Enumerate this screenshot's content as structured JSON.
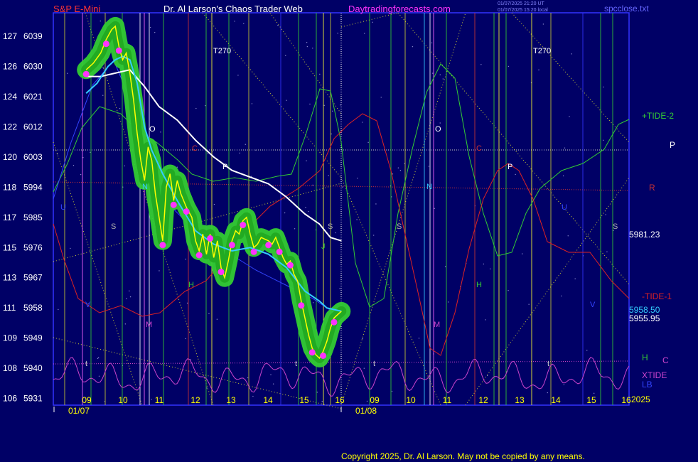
{
  "header": {
    "instrument": "S&P E-Mini",
    "author": "Dr. Al Larson's Chaos Trader Web",
    "site": "Daytradingforecasts.com",
    "timestamp1": "01/07/2025 21:20 UT",
    "timestamp2": "01/07/2025 15:20 local",
    "file": "spcclose.txt"
  },
  "footer": {
    "copyright": "Copyright 2025, Dr. Al Larson. May not be copied by any means."
  },
  "colors": {
    "background": "#000066",
    "plot_border": "#3333ff",
    "price": "#ffff00",
    "white_ma": "#ffffff",
    "cyan_ma": "#33ccff",
    "tide_plus": "#33cc33",
    "tide_minus": "#dd2222",
    "xtide": "#cc44cc"
  },
  "chart_data": {
    "type": "line",
    "y_axis_left": {
      "ticks": [
        {
          "a": "127",
          "b": "6039",
          "v": 6039
        },
        {
          "a": "126",
          "b": "6030",
          "v": 6030
        },
        {
          "a": "124",
          "b": "6021",
          "v": 6021
        },
        {
          "a": "122",
          "b": "6012",
          "v": 6012
        },
        {
          "a": "120",
          "b": "6003",
          "v": 6003
        },
        {
          "a": "118",
          "b": "5994",
          "v": 5994
        },
        {
          "a": "117",
          "b": "5985",
          "v": 5985
        },
        {
          "a": "115",
          "b": "5976",
          "v": 5976
        },
        {
          "a": "113",
          "b": "5967",
          "v": 5967
        },
        {
          "a": "111",
          "b": "5958",
          "v": 5958
        },
        {
          "a": "109",
          "b": "5949",
          "v": 5949
        },
        {
          "a": "108",
          "b": "5940",
          "v": 5940
        },
        {
          "a": "106",
          "b": "5931",
          "v": 5931
        }
      ]
    },
    "ylim": [
      5929,
      6046
    ],
    "x_axis": {
      "hours": [
        "09",
        "10",
        "11",
        "12",
        "13",
        "14",
        "15",
        "16",
        "09",
        "10",
        "11",
        "12",
        "13",
        "14",
        "15",
        "16"
      ],
      "dates": [
        "01/07",
        "01/08"
      ],
      "year": "2025"
    },
    "price_series": [
      [
        0.0,
        6029
      ],
      [
        0.2,
        6031
      ],
      [
        0.4,
        6034
      ],
      [
        0.55,
        6038
      ],
      [
        0.7,
        6041
      ],
      [
        0.8,
        6042
      ],
      [
        0.9,
        6036
      ],
      [
        1.0,
        6032
      ],
      [
        1.1,
        6034
      ],
      [
        1.2,
        6028
      ],
      [
        1.3,
        6020
      ],
      [
        1.4,
        6010
      ],
      [
        1.5,
        6002
      ],
      [
        1.6,
        5996
      ],
      [
        1.7,
        6006
      ],
      [
        1.8,
        6002
      ],
      [
        1.9,
        5992
      ],
      [
        2.0,
        5985
      ],
      [
        2.1,
        5978
      ],
      [
        2.2,
        5994
      ],
      [
        2.3,
        5998
      ],
      [
        2.4,
        5990
      ],
      [
        2.5,
        5996
      ],
      [
        2.6,
        5992
      ],
      [
        2.75,
        5988
      ],
      [
        2.9,
        5985
      ],
      [
        3.0,
        5978
      ],
      [
        3.1,
        5975
      ],
      [
        3.2,
        5980
      ],
      [
        3.3,
        5974
      ],
      [
        3.4,
        5980
      ],
      [
        3.5,
        5973
      ],
      [
        3.6,
        5978
      ],
      [
        3.7,
        5970
      ],
      [
        3.8,
        5967
      ],
      [
        3.9,
        5972
      ],
      [
        4.0,
        5978
      ],
      [
        4.1,
        5981
      ],
      [
        4.2,
        5980
      ],
      [
        4.3,
        5984
      ],
      [
        4.4,
        5985
      ],
      [
        4.5,
        5980
      ],
      [
        4.6,
        5976
      ],
      [
        4.7,
        5977
      ],
      [
        4.8,
        5979
      ],
      [
        5.0,
        5978
      ],
      [
        5.1,
        5977
      ],
      [
        5.2,
        5979
      ],
      [
        5.3,
        5976
      ],
      [
        5.4,
        5973
      ],
      [
        5.5,
        5971
      ],
      [
        5.6,
        5972
      ],
      [
        5.7,
        5968
      ],
      [
        5.8,
        5966
      ],
      [
        5.9,
        5960
      ],
      [
        6.0,
        5955
      ],
      [
        6.1,
        5950
      ],
      [
        6.2,
        5946
      ],
      [
        6.3,
        5944
      ],
      [
        6.4,
        5943
      ],
      [
        6.5,
        5945
      ],
      [
        6.6,
        5948
      ],
      [
        6.7,
        5952
      ],
      [
        6.8,
        5955
      ],
      [
        6.9,
        5956
      ],
      [
        7.0,
        5957
      ]
    ],
    "white_ma": [
      [
        0.0,
        6027
      ],
      [
        0.4,
        6027
      ],
      [
        0.8,
        6028
      ],
      [
        1.2,
        6029
      ],
      [
        1.6,
        6024
      ],
      [
        2.0,
        6018
      ],
      [
        2.5,
        6014
      ],
      [
        3.0,
        6008
      ],
      [
        3.5,
        6003
      ],
      [
        4.0,
        5999
      ],
      [
        4.5,
        5997
      ],
      [
        5.0,
        5995
      ],
      [
        5.5,
        5991
      ],
      [
        6.0,
        5986
      ],
      [
        6.4,
        5983
      ],
      [
        6.7,
        5979
      ],
      [
        7.0,
        5978
      ]
    ],
    "cyan_ma": [
      [
        0.0,
        6022
      ],
      [
        0.3,
        6025
      ],
      [
        0.6,
        6030
      ],
      [
        0.8,
        6032
      ],
      [
        1.0,
        6033
      ],
      [
        1.2,
        6032
      ],
      [
        1.4,
        6025
      ],
      [
        1.6,
        6012
      ],
      [
        1.8,
        6005
      ],
      [
        2.1,
        5998
      ],
      [
        2.5,
        5990
      ],
      [
        3.0,
        5981
      ],
      [
        3.5,
        5977
      ],
      [
        4.0,
        5975
      ],
      [
        4.5,
        5976
      ],
      [
        5.0,
        5974
      ],
      [
        5.5,
        5970
      ],
      [
        6.0,
        5963
      ],
      [
        6.4,
        5960
      ],
      [
        6.6,
        5958
      ],
      [
        7.0,
        5957
      ]
    ],
    "reference_values": {
      "tide_minus_1_price": "5958.50",
      "tide_plus_2_price": "5955.95",
      "close_label": "5981.23"
    },
    "right_labels": {
      "tide_plus": "+TIDE-2",
      "tide_minus": "-TIDE-1",
      "xtide": "XTIDE",
      "lb": "LB",
      "p": "P",
      "r": "R",
      "h": "H",
      "c": "C"
    },
    "annotations": [
      "T270",
      "T270",
      "O",
      "O",
      "P",
      "P",
      "C",
      "C",
      "N",
      "N",
      "S",
      "S",
      "S",
      "S",
      "H",
      "H",
      "M",
      "M",
      "U",
      "U",
      "V",
      "V",
      "J",
      "t",
      "t",
      "t",
      "t"
    ]
  }
}
